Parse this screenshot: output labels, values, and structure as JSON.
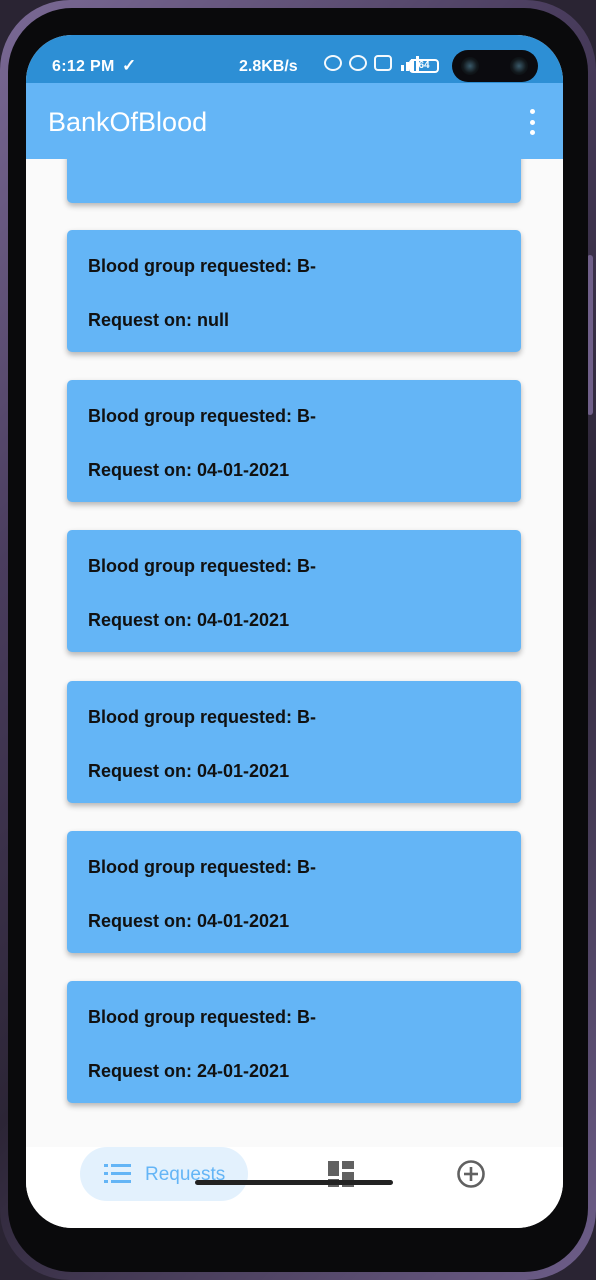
{
  "status_bar": {
    "time": "6:12 PM",
    "check_icon": "✓",
    "net_speed": "2.8KB/s",
    "battery": "64"
  },
  "app_bar": {
    "title": "BankOfBlood",
    "menu_icon": "more-vert-icon"
  },
  "requests": [
    {
      "blood_group": "Blood group requested: B-",
      "request_on": "Request on: null"
    },
    {
      "blood_group": "Blood group requested: B-",
      "request_on": "Request on: 04-01-2021"
    },
    {
      "blood_group": "Blood group requested: B-",
      "request_on": "Request on: 04-01-2021"
    },
    {
      "blood_group": "Blood group requested: B-",
      "request_on": "Request on: 04-01-2021"
    },
    {
      "blood_group": "Blood group requested: B-",
      "request_on": "Request on: 04-01-2021"
    },
    {
      "blood_group": "Blood group requested: B-",
      "request_on": "Request on: 24-01-2021"
    }
  ],
  "bottom_nav": {
    "items": [
      {
        "label": "Requests",
        "icon": "list-icon",
        "active": true
      },
      {
        "label": "",
        "icon": "dashboard-icon",
        "active": false
      },
      {
        "label": "",
        "icon": "add-circle-icon",
        "active": false
      }
    ]
  },
  "colors": {
    "primary": "#64b5f6",
    "status_bar": "#2d8fd5",
    "nav_active_bg": "#e3f1fd"
  }
}
